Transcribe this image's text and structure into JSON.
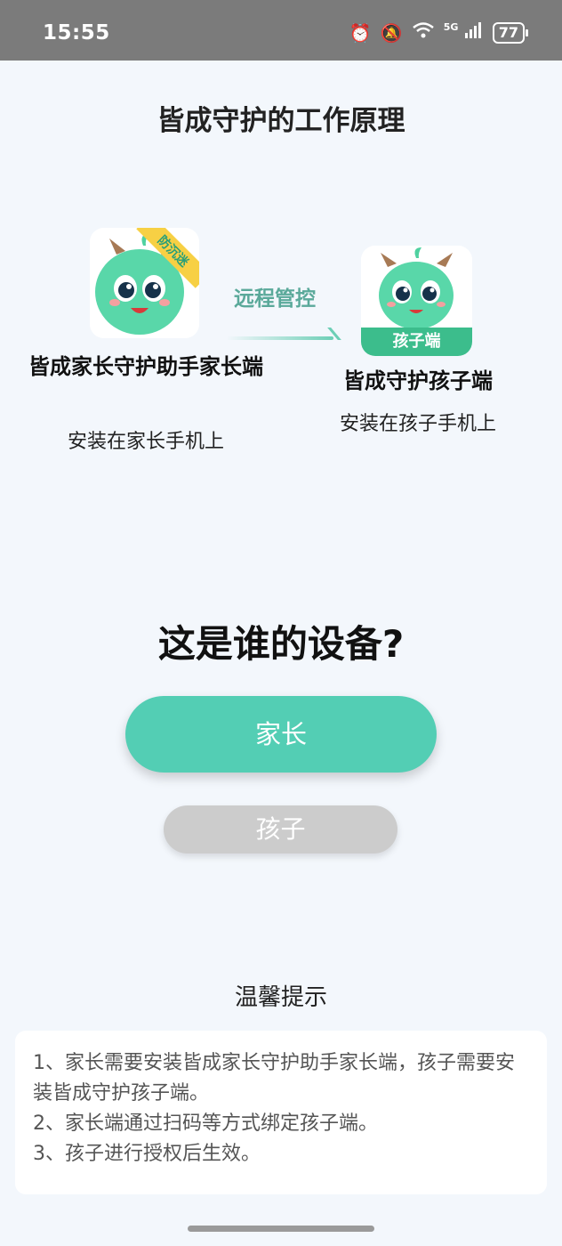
{
  "status_bar": {
    "time": "15:55",
    "signal": "5G",
    "battery": "77"
  },
  "header": {
    "title": "皆成守护的工作原理"
  },
  "diagram": {
    "parent_app": {
      "name": "皆成家长守护助手家长端",
      "note": "安装在家长手机上",
      "ribbon": "防沉迷"
    },
    "arrow_label": "远程管控",
    "child_app": {
      "name": "皆成守护孩子端",
      "note": "安装在孩子手机上",
      "badge": "孩子端"
    }
  },
  "question": "这是谁的设备?",
  "buttons": {
    "parent": "家长",
    "child": "孩子"
  },
  "tips": {
    "title": "温馨提示",
    "items": [
      "1、家长需要安装皆成家长守护助手家长端，孩子需要安装皆成守护孩子端。",
      "2、家长端通过扫码等方式绑定孩子端。",
      "3、孩子进行授权后生效。"
    ]
  },
  "colors": {
    "accent": "#53ceb4",
    "disabled": "#cccccc",
    "background": "#f3f7fc",
    "statusbar": "#7b7b7b"
  }
}
